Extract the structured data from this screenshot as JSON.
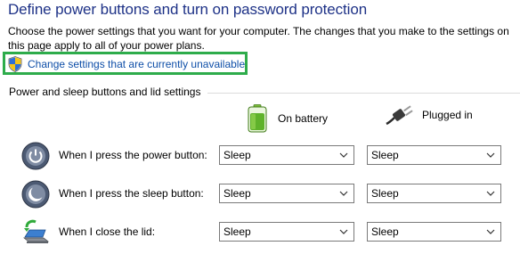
{
  "header": {
    "title": "Define power buttons and turn on password protection",
    "description": "Choose the power settings that you want for your computer. The changes that you make to the settings on this page apply to all of your power plans.",
    "change_link": "Change settings that are currently unavailable"
  },
  "section": {
    "title": "Power and sleep buttons and lid settings"
  },
  "columns": {
    "battery": "On battery",
    "plugged": "Plugged in"
  },
  "rows": [
    {
      "label": "When I press the power button:",
      "battery": "Sleep",
      "plugged": "Sleep",
      "icon": "power-button-icon"
    },
    {
      "label": "When I press the sleep button:",
      "battery": "Sleep",
      "plugged": "Sleep",
      "icon": "sleep-button-icon"
    },
    {
      "label": "When I close the lid:",
      "battery": "Sleep",
      "plugged": "Sleep",
      "icon": "laptop-lid-icon"
    }
  ],
  "colors": {
    "title": "#1e3287",
    "link": "#0f4fa8",
    "highlight": "#2eac4b"
  }
}
